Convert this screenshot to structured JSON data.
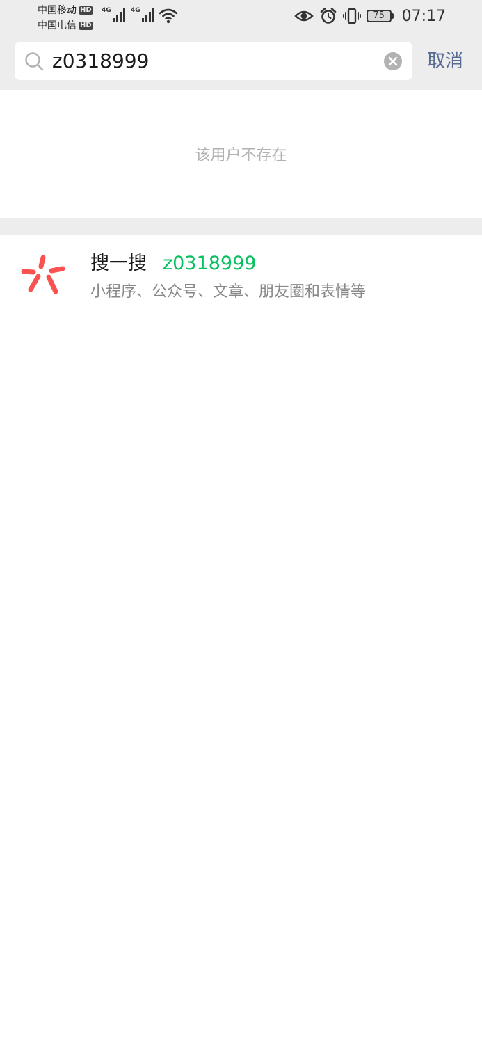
{
  "status_bar": {
    "carrier_1": "中国移动",
    "carrier_2": "中国电信",
    "hd_badge": "HD",
    "network_1": "4G",
    "network_2": "4G",
    "battery_level": "75",
    "time": "07:17"
  },
  "search": {
    "query": "z0318999",
    "cancel_label": "取消"
  },
  "empty_result": {
    "message": "该用户不存在"
  },
  "sousou": {
    "title": "搜一搜",
    "keyword": "z0318999",
    "subtitle": "小程序、公众号、文章、朋友圈和表情等",
    "logo_color": "#fa5151",
    "keyword_color": "#07c160"
  },
  "colors": {
    "background_top": "#ededed",
    "link_blue": "#576b95"
  }
}
